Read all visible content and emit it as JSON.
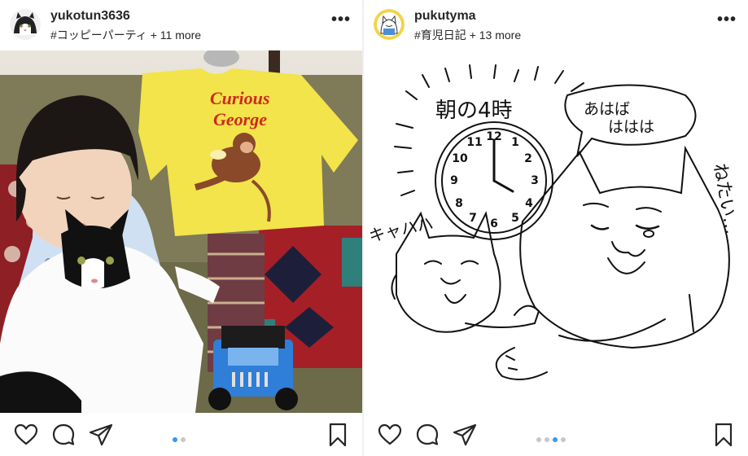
{
  "posts": [
    {
      "username": "yukotun3636",
      "hashtag": "#コッピーパーティ",
      "more_tags": "+ 11 more",
      "more_menu": "•••",
      "photo": {
        "shirt_text_line1": "Curious",
        "shirt_text_line2": "George"
      },
      "carousel": {
        "count": 2,
        "active": 1
      }
    },
    {
      "username": "pukutyma",
      "hashtag": "#育児日記",
      "more_tags": "+ 13 more",
      "more_menu": "•••",
      "photo": {
        "title_text": "朝の4時",
        "speech_text_line1": "あはば",
        "speech_text_line2": "ははは",
        "laugh_text": "キャハハ",
        "sleepy_text": "ねたい…",
        "clock_numbers": [
          "12",
          "1",
          "2",
          "3",
          "4",
          "5",
          "6",
          "7",
          "8",
          "9",
          "10",
          "11"
        ]
      },
      "carousel": {
        "count": 4,
        "active": 3
      }
    }
  ],
  "icons": [
    "heart-icon",
    "comment-icon",
    "share-icon",
    "bookmark-icon",
    "more-icon"
  ],
  "colors": {
    "accent_dot": "#3897f0",
    "inactive_dot": "#c7c7c7",
    "text": "#262626"
  }
}
